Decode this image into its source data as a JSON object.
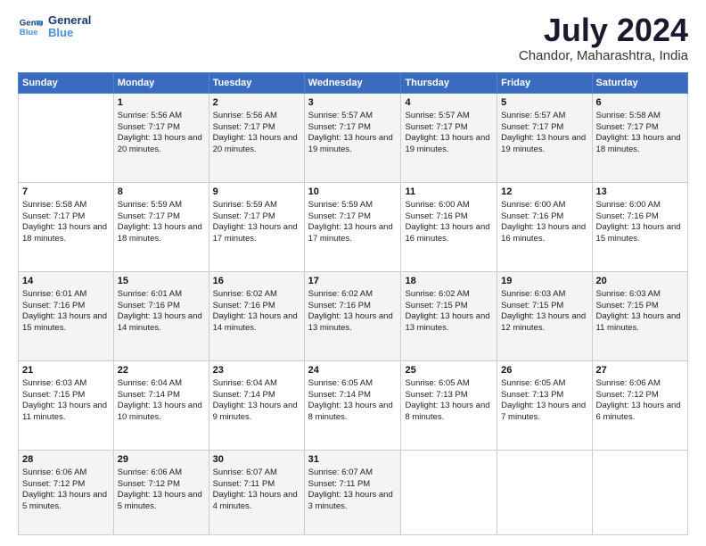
{
  "header": {
    "logo_line1": "General",
    "logo_line2": "Blue",
    "month_title": "July 2024",
    "location": "Chandor, Maharashtra, India"
  },
  "days_of_week": [
    "Sunday",
    "Monday",
    "Tuesday",
    "Wednesday",
    "Thursday",
    "Friday",
    "Saturday"
  ],
  "weeks": [
    [
      {
        "day": "",
        "sunrise": "",
        "sunset": "",
        "daylight": ""
      },
      {
        "day": "1",
        "sunrise": "Sunrise: 5:56 AM",
        "sunset": "Sunset: 7:17 PM",
        "daylight": "Daylight: 13 hours and 20 minutes."
      },
      {
        "day": "2",
        "sunrise": "Sunrise: 5:56 AM",
        "sunset": "Sunset: 7:17 PM",
        "daylight": "Daylight: 13 hours and 20 minutes."
      },
      {
        "day": "3",
        "sunrise": "Sunrise: 5:57 AM",
        "sunset": "Sunset: 7:17 PM",
        "daylight": "Daylight: 13 hours and 19 minutes."
      },
      {
        "day": "4",
        "sunrise": "Sunrise: 5:57 AM",
        "sunset": "Sunset: 7:17 PM",
        "daylight": "Daylight: 13 hours and 19 minutes."
      },
      {
        "day": "5",
        "sunrise": "Sunrise: 5:57 AM",
        "sunset": "Sunset: 7:17 PM",
        "daylight": "Daylight: 13 hours and 19 minutes."
      },
      {
        "day": "6",
        "sunrise": "Sunrise: 5:58 AM",
        "sunset": "Sunset: 7:17 PM",
        "daylight": "Daylight: 13 hours and 18 minutes."
      }
    ],
    [
      {
        "day": "7",
        "sunrise": "Sunrise: 5:58 AM",
        "sunset": "Sunset: 7:17 PM",
        "daylight": "Daylight: 13 hours and 18 minutes."
      },
      {
        "day": "8",
        "sunrise": "Sunrise: 5:59 AM",
        "sunset": "Sunset: 7:17 PM",
        "daylight": "Daylight: 13 hours and 18 minutes."
      },
      {
        "day": "9",
        "sunrise": "Sunrise: 5:59 AM",
        "sunset": "Sunset: 7:17 PM",
        "daylight": "Daylight: 13 hours and 17 minutes."
      },
      {
        "day": "10",
        "sunrise": "Sunrise: 5:59 AM",
        "sunset": "Sunset: 7:17 PM",
        "daylight": "Daylight: 13 hours and 17 minutes."
      },
      {
        "day": "11",
        "sunrise": "Sunrise: 6:00 AM",
        "sunset": "Sunset: 7:16 PM",
        "daylight": "Daylight: 13 hours and 16 minutes."
      },
      {
        "day": "12",
        "sunrise": "Sunrise: 6:00 AM",
        "sunset": "Sunset: 7:16 PM",
        "daylight": "Daylight: 13 hours and 16 minutes."
      },
      {
        "day": "13",
        "sunrise": "Sunrise: 6:00 AM",
        "sunset": "Sunset: 7:16 PM",
        "daylight": "Daylight: 13 hours and 15 minutes."
      }
    ],
    [
      {
        "day": "14",
        "sunrise": "Sunrise: 6:01 AM",
        "sunset": "Sunset: 7:16 PM",
        "daylight": "Daylight: 13 hours and 15 minutes."
      },
      {
        "day": "15",
        "sunrise": "Sunrise: 6:01 AM",
        "sunset": "Sunset: 7:16 PM",
        "daylight": "Daylight: 13 hours and 14 minutes."
      },
      {
        "day": "16",
        "sunrise": "Sunrise: 6:02 AM",
        "sunset": "Sunset: 7:16 PM",
        "daylight": "Daylight: 13 hours and 14 minutes."
      },
      {
        "day": "17",
        "sunrise": "Sunrise: 6:02 AM",
        "sunset": "Sunset: 7:16 PM",
        "daylight": "Daylight: 13 hours and 13 minutes."
      },
      {
        "day": "18",
        "sunrise": "Sunrise: 6:02 AM",
        "sunset": "Sunset: 7:15 PM",
        "daylight": "Daylight: 13 hours and 13 minutes."
      },
      {
        "day": "19",
        "sunrise": "Sunrise: 6:03 AM",
        "sunset": "Sunset: 7:15 PM",
        "daylight": "Daylight: 13 hours and 12 minutes."
      },
      {
        "day": "20",
        "sunrise": "Sunrise: 6:03 AM",
        "sunset": "Sunset: 7:15 PM",
        "daylight": "Daylight: 13 hours and 11 minutes."
      }
    ],
    [
      {
        "day": "21",
        "sunrise": "Sunrise: 6:03 AM",
        "sunset": "Sunset: 7:15 PM",
        "daylight": "Daylight: 13 hours and 11 minutes."
      },
      {
        "day": "22",
        "sunrise": "Sunrise: 6:04 AM",
        "sunset": "Sunset: 7:14 PM",
        "daylight": "Daylight: 13 hours and 10 minutes."
      },
      {
        "day": "23",
        "sunrise": "Sunrise: 6:04 AM",
        "sunset": "Sunset: 7:14 PM",
        "daylight": "Daylight: 13 hours and 9 minutes."
      },
      {
        "day": "24",
        "sunrise": "Sunrise: 6:05 AM",
        "sunset": "Sunset: 7:14 PM",
        "daylight": "Daylight: 13 hours and 8 minutes."
      },
      {
        "day": "25",
        "sunrise": "Sunrise: 6:05 AM",
        "sunset": "Sunset: 7:13 PM",
        "daylight": "Daylight: 13 hours and 8 minutes."
      },
      {
        "day": "26",
        "sunrise": "Sunrise: 6:05 AM",
        "sunset": "Sunset: 7:13 PM",
        "daylight": "Daylight: 13 hours and 7 minutes."
      },
      {
        "day": "27",
        "sunrise": "Sunrise: 6:06 AM",
        "sunset": "Sunset: 7:12 PM",
        "daylight": "Daylight: 13 hours and 6 minutes."
      }
    ],
    [
      {
        "day": "28",
        "sunrise": "Sunrise: 6:06 AM",
        "sunset": "Sunset: 7:12 PM",
        "daylight": "Daylight: 13 hours and 5 minutes."
      },
      {
        "day": "29",
        "sunrise": "Sunrise: 6:06 AM",
        "sunset": "Sunset: 7:12 PM",
        "daylight": "Daylight: 13 hours and 5 minutes."
      },
      {
        "day": "30",
        "sunrise": "Sunrise: 6:07 AM",
        "sunset": "Sunset: 7:11 PM",
        "daylight": "Daylight: 13 hours and 4 minutes."
      },
      {
        "day": "31",
        "sunrise": "Sunrise: 6:07 AM",
        "sunset": "Sunset: 7:11 PM",
        "daylight": "Daylight: 13 hours and 3 minutes."
      },
      {
        "day": "",
        "sunrise": "",
        "sunset": "",
        "daylight": ""
      },
      {
        "day": "",
        "sunrise": "",
        "sunset": "",
        "daylight": ""
      },
      {
        "day": "",
        "sunrise": "",
        "sunset": "",
        "daylight": ""
      }
    ]
  ]
}
